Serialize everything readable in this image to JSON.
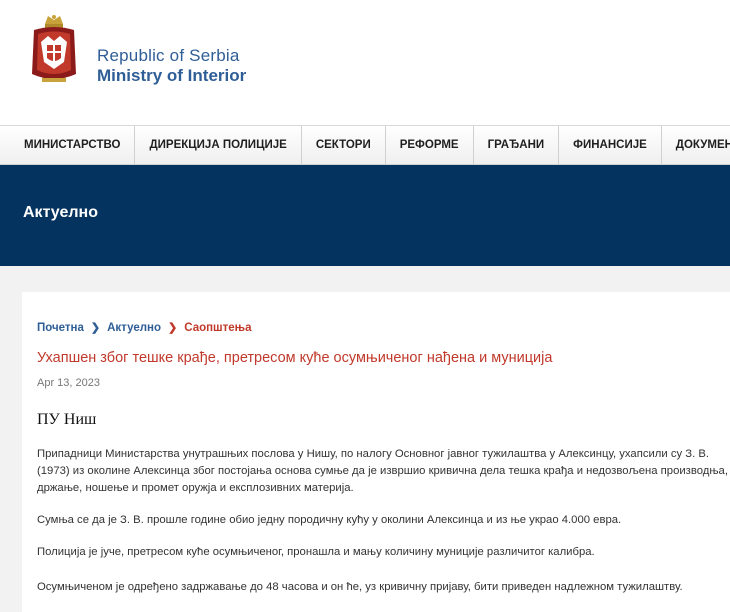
{
  "brand": {
    "line1": "Republic of Serbia",
    "line2": "Ministry of Interior"
  },
  "nav": {
    "items": [
      "МИНИСТАРСТВО",
      "ДИРЕКЦИЈА ПОЛИЦИЈЕ",
      "СЕКТОРИ",
      "РЕФОРМЕ",
      "ГРАЂАНИ",
      "ФИНАНСИЈЕ",
      "ДОКУМЕНТИ"
    ]
  },
  "banner": {
    "title": "Актуелно"
  },
  "breadcrumb": {
    "home": "Почетна",
    "section": "Актуелно",
    "current": "Саопштења"
  },
  "article": {
    "title": "Ухапшен због тешке крађе, претресом куће осумњиченог нађена и муниција",
    "date": "Apr 13, 2023",
    "unit": "ПУ Ниш",
    "paragraphs": [
      "Припадници Министарства унутрашњих послова у Нишу, по налогу Основног јавног тужилаштва у Алексинцу, ухапсили су З. В. (1973) из околине Алексинца због постојања основа сумње да је извршио кривична дела тешка крађа и недозвољена производња, држање, ношење и промет оружја и експлозивних материја.",
      "Сумња се да је З. В. прошле године обио једну породичну кућу у околини Алексинца и из ње украо 4.000 евра.",
      "Полиција је јуче, претресом куће осумњиченог, пронашла и мању количину муниције различитог калибра.",
      "Осумњиченом је одређено задржавање до 48 часова и он ће, уз кривичну пријаву, бити приведен надлежном тужилаштву."
    ]
  },
  "colors": {
    "brand_blue": "#2f5e96",
    "banner_navy": "#05335f",
    "accent_red": "#c0392b"
  }
}
